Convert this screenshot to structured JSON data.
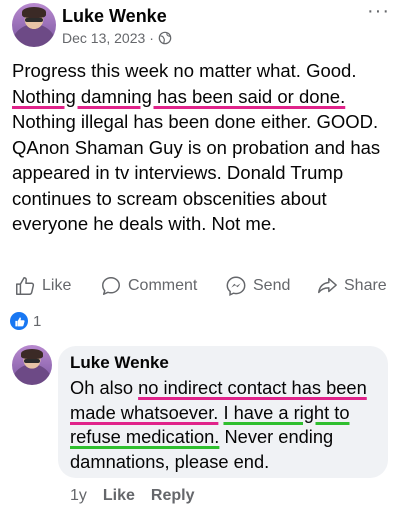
{
  "post": {
    "author": "Luke Wenke",
    "date": "Dec 13, 2023",
    "separator": "·",
    "more_label": "···",
    "text": {
      "p1": "Progress this week no matter what. Good.  ",
      "p2": "Nothing damning has been said or done.",
      "p3": "  Nothing illegal has been done either.  GOOD.  QAnon Shaman Guy is on probation and has appeared in tv interviews.  Donald Trump continues to scream obscenities about everyone he deals with.  Not me."
    },
    "actions": {
      "like": "Like",
      "comment": "Comment",
      "send": "Send",
      "share": "Share"
    },
    "reaction_count": "1"
  },
  "comment": {
    "author": "Luke Wenke",
    "text": {
      "p1": "Oh also ",
      "p2": "no indirect contact has been made whatsoever.",
      "p3": "  ",
      "p4": "I have a right to refuse medication.",
      "p5": "  Never ending damnations, please end."
    },
    "age": "1y",
    "like": "Like",
    "reply": "Reply"
  },
  "colors": {
    "highlight_pink": "#e0238a",
    "highlight_green": "#2fbf2f",
    "like_blue": "#1877f2",
    "secondary_text": "#65676b",
    "bubble_bg": "#f0f2f5"
  }
}
